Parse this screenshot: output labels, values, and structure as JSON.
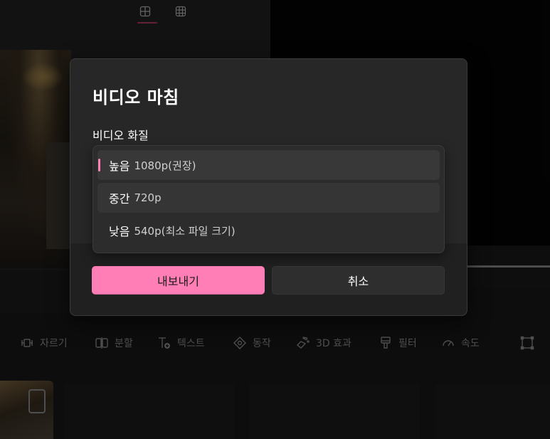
{
  "dialog": {
    "title": "비디오 마침",
    "quality_label": "비디오 화질",
    "options": [
      {
        "name": "높음",
        "detail": "1080p(권장)",
        "selected": true
      },
      {
        "name": "중간",
        "detail": "720p",
        "selected": false
      },
      {
        "name": "낮음",
        "detail": "540p(최소 파일 크기)",
        "selected": false
      }
    ],
    "export_label": "내보내기",
    "cancel_label": "취소"
  },
  "toolbar": {
    "items": [
      {
        "label": "자르기",
        "icon": "trim-icon"
      },
      {
        "label": "분할",
        "icon": "split-icon"
      },
      {
        "label": "텍스트",
        "icon": "text-icon"
      },
      {
        "label": "동작",
        "icon": "motion-icon"
      },
      {
        "label": "3D 효과",
        "icon": "3d-effects-icon"
      },
      {
        "label": "필터",
        "icon": "filter-icon"
      },
      {
        "label": "속도",
        "icon": "speed-icon"
      }
    ],
    "extra_icon": "crop-icon"
  },
  "layout_tools": [
    "layout-grid-2x2-icon",
    "layout-grid-3x3-icon"
  ],
  "colors": {
    "accent": "#ff7eb6",
    "dialog_bg": "#272727",
    "app_bg": "#121212"
  }
}
